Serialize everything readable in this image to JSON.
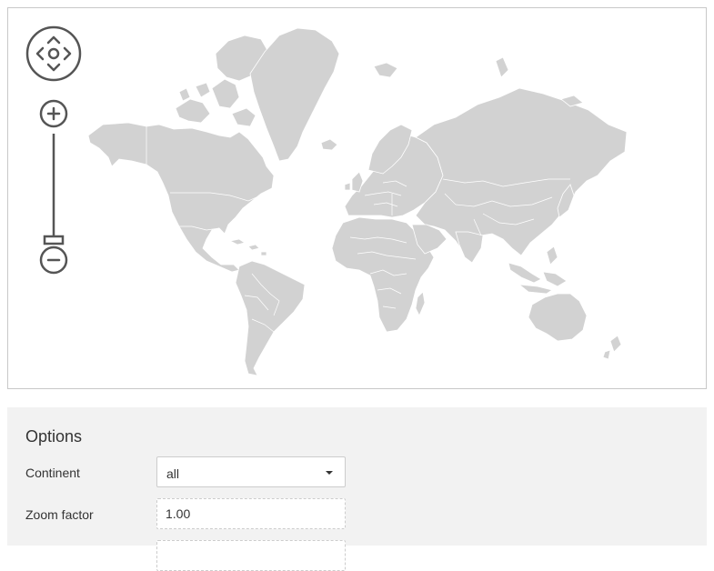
{
  "map": {
    "navigation_control_icon": "pan-arrows-icon",
    "zoom_in_icon": "plus-icon",
    "zoom_out_icon": "minus-icon",
    "zoom_level": 0.0,
    "land_color": "#d2d2d2",
    "border_color": "#ffffff",
    "control_color": "#555555"
  },
  "options": {
    "title": "Options",
    "continent": {
      "label": "Continent",
      "value": "all"
    },
    "zoom_factor": {
      "label": "Zoom factor",
      "value": "1.00"
    }
  }
}
